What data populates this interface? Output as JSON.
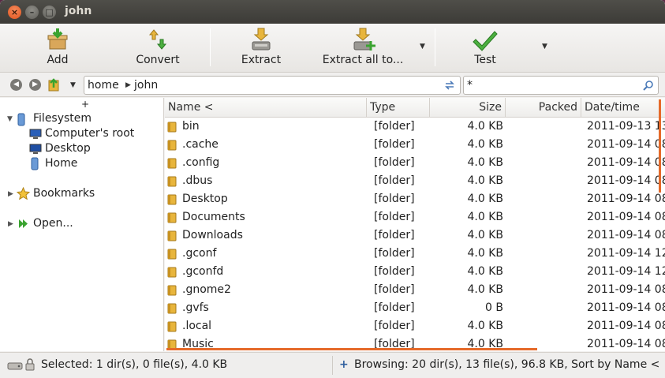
{
  "window": {
    "title": "john"
  },
  "toolbar": {
    "add_label": "Add",
    "convert_label": "Convert",
    "extract_label": "Extract",
    "extract_all_label": "Extract all to...",
    "test_label": "Test"
  },
  "location": {
    "crumbs": [
      "home",
      "john"
    ],
    "filter_value": "*"
  },
  "tree": {
    "expander": "+",
    "filesystem": "Filesystem",
    "computers_root": "Computer's root",
    "desktop": "Desktop",
    "home": "Home",
    "bookmarks": "Bookmarks",
    "open": "Open..."
  },
  "list": {
    "columns": [
      "Name <",
      "Type",
      "Size",
      "Packed",
      "Date/time"
    ],
    "rows": [
      {
        "name": "bin",
        "type": "[folder]",
        "size": "4.0 KB",
        "packed": "",
        "date": "2011-09-13 13:"
      },
      {
        "name": ".cache",
        "type": "[folder]",
        "size": "4.0 KB",
        "packed": "",
        "date": "2011-09-14 08:"
      },
      {
        "name": ".config",
        "type": "[folder]",
        "size": "4.0 KB",
        "packed": "",
        "date": "2011-09-14 08:"
      },
      {
        "name": ".dbus",
        "type": "[folder]",
        "size": "4.0 KB",
        "packed": "",
        "date": "2011-09-14 08:"
      },
      {
        "name": "Desktop",
        "type": "[folder]",
        "size": "4.0 KB",
        "packed": "",
        "date": "2011-09-14 08:"
      },
      {
        "name": "Documents",
        "type": "[folder]",
        "size": "4.0 KB",
        "packed": "",
        "date": "2011-09-14 08:"
      },
      {
        "name": "Downloads",
        "type": "[folder]",
        "size": "4.0 KB",
        "packed": "",
        "date": "2011-09-14 08:"
      },
      {
        "name": ".gconf",
        "type": "[folder]",
        "size": "4.0 KB",
        "packed": "",
        "date": "2011-09-14 12:"
      },
      {
        "name": ".gconfd",
        "type": "[folder]",
        "size": "4.0 KB",
        "packed": "",
        "date": "2011-09-14 12:"
      },
      {
        "name": ".gnome2",
        "type": "[folder]",
        "size": "4.0 KB",
        "packed": "",
        "date": "2011-09-14 08:"
      },
      {
        "name": ".gvfs",
        "type": "[folder]",
        "size": "0 B",
        "packed": "",
        "date": "2011-09-14 08:"
      },
      {
        "name": ".local",
        "type": "[folder]",
        "size": "4.0 KB",
        "packed": "",
        "date": "2011-09-14 08:"
      },
      {
        "name": "Music",
        "type": "[folder]",
        "size": "4.0 KB",
        "packed": "",
        "date": "2011-09-14 08:"
      }
    ]
  },
  "status": {
    "selected": "Selected: 1 dir(s), 0 file(s), 4.0 KB",
    "browsing_prefix": "+",
    "browsing": "Browsing: 20 dir(s), 13 file(s), 96.8 KB, Sort by Name <"
  },
  "colors": {
    "accent": "#e56a2a",
    "folder": "#e8b53c",
    "titlebar": "#3c3b37"
  }
}
